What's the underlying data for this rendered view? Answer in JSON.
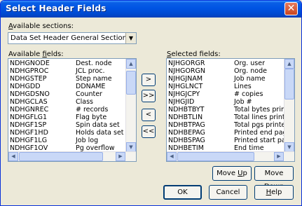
{
  "window": {
    "title": "Select Header Fields",
    "close_glyph": "✕"
  },
  "sections": {
    "label_pre": "",
    "label_u": "A",
    "label_post": "vailable sections:",
    "selected": "Data Set Header General Section"
  },
  "available": {
    "label_pre": "Available ",
    "label_u": "f",
    "label_post": "ields:",
    "rows": [
      [
        "NDHGNODE",
        "Dest. node"
      ],
      [
        "NDHGPROC",
        "JCL proc."
      ],
      [
        "NDHGSTEP",
        "Step name"
      ],
      [
        "NDHGDD",
        "DDNAME"
      ],
      [
        "NDHGDSNO",
        "Counter"
      ],
      [
        "NDHGCLAS",
        "Class"
      ],
      [
        "NDHGNREC",
        "# records"
      ],
      [
        "NDHGFLG1",
        "Flag byte"
      ],
      [
        "NDHGF1SP",
        "Spin data set"
      ],
      [
        "NDHGF1HD",
        "Holds data set"
      ],
      [
        "NDHGF1LG",
        "Job log"
      ],
      [
        "NDHGF1OV",
        "Pg overflow"
      ]
    ]
  },
  "selected": {
    "label_pre": "",
    "label_u": "S",
    "label_post": "elected fields:",
    "rows": [
      [
        "NJHGORGR",
        "Org. user"
      ],
      [
        "NJHGORGN",
        "Org. node"
      ],
      [
        "NJHGJNAM",
        "Job name"
      ],
      [
        "NJHGLNCT",
        "Lines"
      ],
      [
        "NJHGJCPY",
        "# copies"
      ],
      [
        "NJHGJID",
        "Job #"
      ],
      [
        "NDHBTBYT",
        "Total bytes printed"
      ],
      [
        "NDHBTLIN",
        "Total lines printed"
      ],
      [
        "NDHBTPAG",
        "Total pgs printed"
      ],
      [
        "NDHBEPAG",
        "Printed end page"
      ],
      [
        "NDHBSPAG",
        "Printed start page"
      ],
      [
        "NDHBETIM",
        "End time"
      ]
    ]
  },
  "transfer": {
    "add_one": ">",
    "add_all": ">>",
    "remove_one": "<",
    "remove_all": "<<"
  },
  "buttons": {
    "move_up_pre": "Move ",
    "move_up_u": "U",
    "move_up_post": "p",
    "move_down_pre": "Move ",
    "move_down_u": "D",
    "move_down_post": "own",
    "ok": "OK",
    "cancel": "Cancel",
    "help_u": "H",
    "help_post": "elp"
  },
  "icons": {
    "dropdown": "▼",
    "up": "▲",
    "down": "▼",
    "left": "◀",
    "right": "▶"
  }
}
